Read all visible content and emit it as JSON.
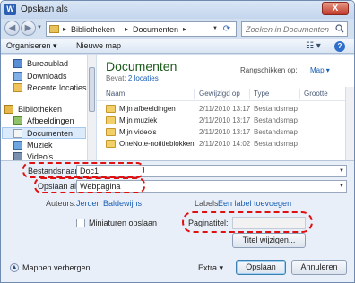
{
  "window": {
    "title": "Opslaan als",
    "close_glyph": "X",
    "app_glyph": "W"
  },
  "nav": {
    "back_glyph": "◀",
    "forward_glyph": "▶"
  },
  "breadcrumb": {
    "items": [
      "Bibliotheken",
      "Documenten"
    ]
  },
  "search": {
    "placeholder": "Zoeken in Documenten"
  },
  "toolbar": {
    "organize_label": "Organiseren ▾",
    "new_folder_label": "Nieuwe map"
  },
  "sidebar": {
    "items": [
      {
        "label": "Bureaublad",
        "icon": "desktop-icon"
      },
      {
        "label": "Downloads",
        "icon": "downloads-icon"
      },
      {
        "label": "Recente locaties",
        "icon": "recent-places-icon"
      },
      {
        "label": "Bibliotheken",
        "icon": "libraries-icon"
      },
      {
        "label": "Afbeeldingen",
        "icon": "pictures-icon"
      },
      {
        "label": "Documenten",
        "icon": "documents-icon",
        "selected": true
      },
      {
        "label": "Muziek",
        "icon": "music-icon"
      },
      {
        "label": "Video's",
        "icon": "videos-icon"
      }
    ]
  },
  "library": {
    "title": "Documenten",
    "includes_label": "Bevat:",
    "includes_value": "2 locaties",
    "arrange_label": "Rangschikken op:",
    "arrange_value": "Map ▾"
  },
  "columns": {
    "name": "Naam",
    "date": "Gewijzigd op",
    "type": "Type",
    "size": "Grootte"
  },
  "files": [
    {
      "name": "Mijn afbeeldingen",
      "date": "2/11/2010 13:17",
      "type": "Bestandsmap"
    },
    {
      "name": "Mijn muziek",
      "date": "2/11/2010 13:17",
      "type": "Bestandsmap"
    },
    {
      "name": "Mijn video's",
      "date": "2/11/2010 13:17",
      "type": "Bestandsmap"
    },
    {
      "name": "OneNote-notitieblokken",
      "date": "2/11/2010 14:02",
      "type": "Bestandsmap"
    }
  ],
  "form": {
    "filename_label": "Bestandsnaam:",
    "filename_value": "Doc1",
    "savetype_label": "Opslaan als:",
    "savetype_value": "Webpagina",
    "authors_label": "Auteurs:",
    "authors_value": "Jeroen Baldewijns",
    "tags_label": "Labels:",
    "tags_value": "Een label toevoegen",
    "thumbnails_label": "Miniaturen opslaan",
    "pagetitle_label": "Paginatitel:",
    "pagetitle_value": "",
    "change_title_label": "Titel wijzigen...",
    "hide_folders_label": "Mappen verbergen",
    "extra_label": "Extra ▾",
    "save_label": "Opslaan",
    "cancel_label": "Annuleren"
  },
  "colors": {
    "highlight": "#e01010",
    "link": "#1a5fb4",
    "library_title": "#1e5c1e"
  }
}
